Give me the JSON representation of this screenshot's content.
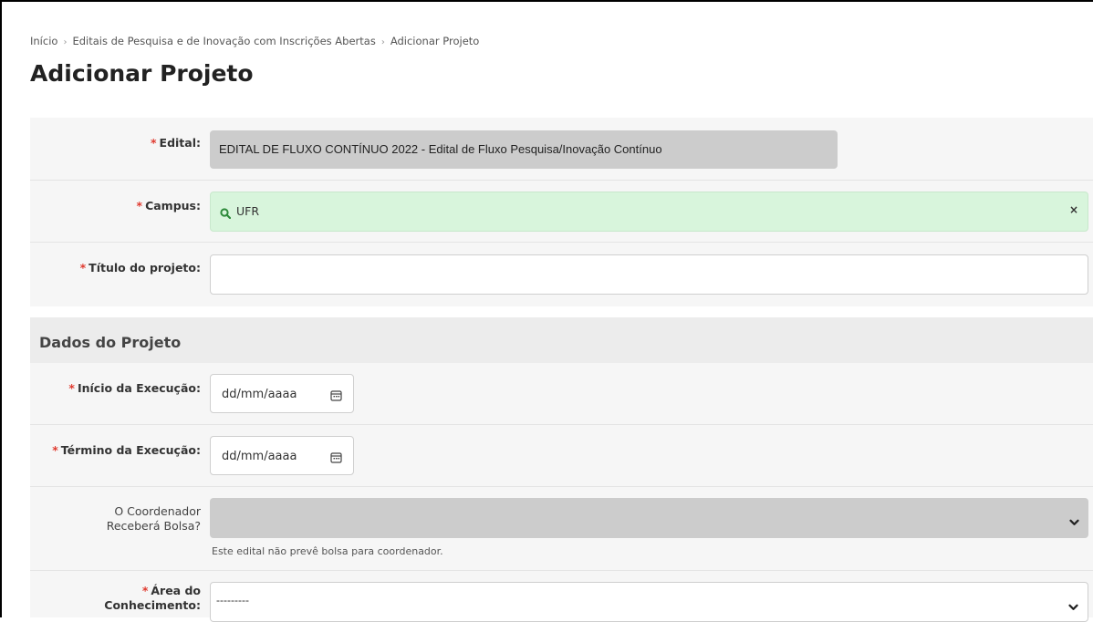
{
  "breadcrumb": {
    "items": [
      "Início",
      "Editais de Pesquisa e de Inovação com Inscrições Abertas",
      "Adicionar Projeto"
    ],
    "separator": "›"
  },
  "page_title": "Adicionar Projeto",
  "required_mark": "*",
  "form": {
    "edital": {
      "label": "Edital:",
      "value": "EDITAL DE FLUXO CONTÍNUO  2022 - Edital de Fluxo Pesquisa/Inovação Contínuo"
    },
    "campus": {
      "label": "Campus:",
      "value": "UFR",
      "clear": "×",
      "icon": "search-icon"
    },
    "titulo": {
      "label": "Título do projeto:",
      "value": ""
    }
  },
  "section": {
    "title": "Dados do Projeto",
    "inicio": {
      "label": "Início da Execução:",
      "placeholder": "dd/mm/aaaa",
      "icon": "calendar-icon"
    },
    "termino": {
      "label": "Término da Execução:",
      "placeholder": "dd/mm/aaaa",
      "icon": "calendar-icon"
    },
    "bolsa": {
      "label_line1": "O Coordenador",
      "label_line2": "Receberá Bolsa?",
      "value": "",
      "help": "Este edital não prevê bolsa para coordenador.",
      "icon": "chevron-down-icon"
    },
    "area": {
      "label_line1": "Área do",
      "label_line2": "Conhecimento:",
      "value": "---------",
      "icon": "chevron-down-icon"
    }
  },
  "colors": {
    "required": "#e03a2f",
    "valid_bg": "#d8f5dc",
    "disabled_bg": "#cccccc",
    "panel_bg": "#f6f6f6"
  }
}
